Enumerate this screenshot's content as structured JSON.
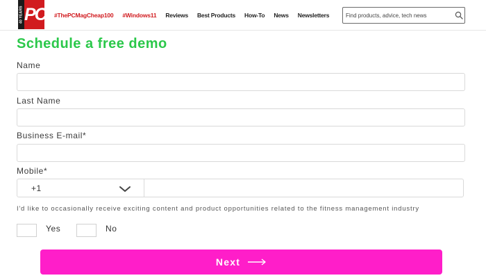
{
  "header": {
    "logo": {
      "mark": "PC",
      "badge": "40 YEARS"
    },
    "nav": [
      {
        "label": "#ThePCMagCheap100",
        "highlight": true
      },
      {
        "label": "#Windows11",
        "highlight": true
      },
      {
        "label": "Reviews",
        "highlight": false
      },
      {
        "label": "Best Products",
        "highlight": false
      },
      {
        "label": "How-To",
        "highlight": false
      },
      {
        "label": "News",
        "highlight": false
      },
      {
        "label": "Newsletters",
        "highlight": false
      }
    ],
    "search": {
      "placeholder": "Find products, advice, tech news",
      "icon": "search-icon"
    }
  },
  "form": {
    "title": "Schedule a free demo",
    "fields": {
      "name": {
        "label": "Name",
        "value": ""
      },
      "last_name": {
        "label": "Last Name",
        "value": ""
      },
      "email": {
        "label": "Business E-mail*",
        "value": ""
      },
      "mobile": {
        "label": "Mobile*",
        "country_code": "+1",
        "value": ""
      }
    },
    "consent": {
      "text": "I'd like to occasionally receive exciting content and product opportunities related to the fitness management industry",
      "options": [
        "Yes",
        "No"
      ]
    },
    "submit": {
      "label": "Next",
      "icon": "arrow-right-icon"
    }
  },
  "colors": {
    "brand_red": "#d11b1f",
    "title_green": "#2bc84a",
    "button_pink": "#ff1ec9"
  }
}
